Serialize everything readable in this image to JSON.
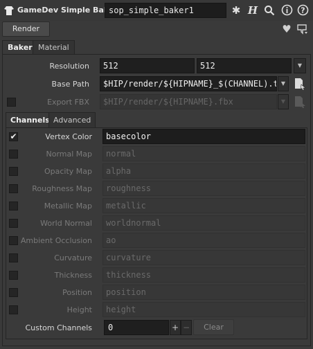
{
  "header": {
    "node_type": "GameDev Simple Baker",
    "node_name": "sop_simple_baker1",
    "icons": [
      "gear-icon",
      "houdini-h-icon",
      "search-icon",
      "info-icon",
      "help-icon"
    ]
  },
  "toolbar": {
    "render_label": "Render",
    "icons": [
      "heart-icon",
      "preset-dropdown-icon"
    ]
  },
  "tabs": {
    "baker": "Baker",
    "material": "Material"
  },
  "parms": {
    "resolution_label": "Resolution",
    "res_x": "512",
    "res_y": "512",
    "base_path_label": "Base Path",
    "base_path": "$HIP/render/${HIPNAME}_$(CHANNEL).t",
    "export_fbx_label": "Export FBX",
    "fbx_path": "$HIP/render/${HIPNAME}.fbx"
  },
  "subtabs": {
    "channels": "Channels",
    "advanced": "Advanced"
  },
  "channels": [
    {
      "label": "Vertex Color",
      "value": "basecolor",
      "enabled": true
    },
    {
      "label": "Normal Map",
      "value": "normal",
      "enabled": false
    },
    {
      "label": "Opacity Map",
      "value": "alpha",
      "enabled": false
    },
    {
      "label": "Roughness Map",
      "value": "roughness",
      "enabled": false
    },
    {
      "label": "Metallic Map",
      "value": "metallic",
      "enabled": false
    },
    {
      "label": "World Normal",
      "value": "worldnormal",
      "enabled": false
    },
    {
      "label": "Ambient Occlusion",
      "value": "ao",
      "enabled": false
    },
    {
      "label": "Curvature",
      "value": "curvature",
      "enabled": false
    },
    {
      "label": "Thickness",
      "value": "thickness",
      "enabled": false
    },
    {
      "label": "Position",
      "value": "position",
      "enabled": false
    },
    {
      "label": "Height",
      "value": "height",
      "enabled": false
    }
  ],
  "custom": {
    "label": "Custom Channels",
    "count": "0",
    "plus": "+",
    "minus": "−",
    "clear": "Clear"
  }
}
